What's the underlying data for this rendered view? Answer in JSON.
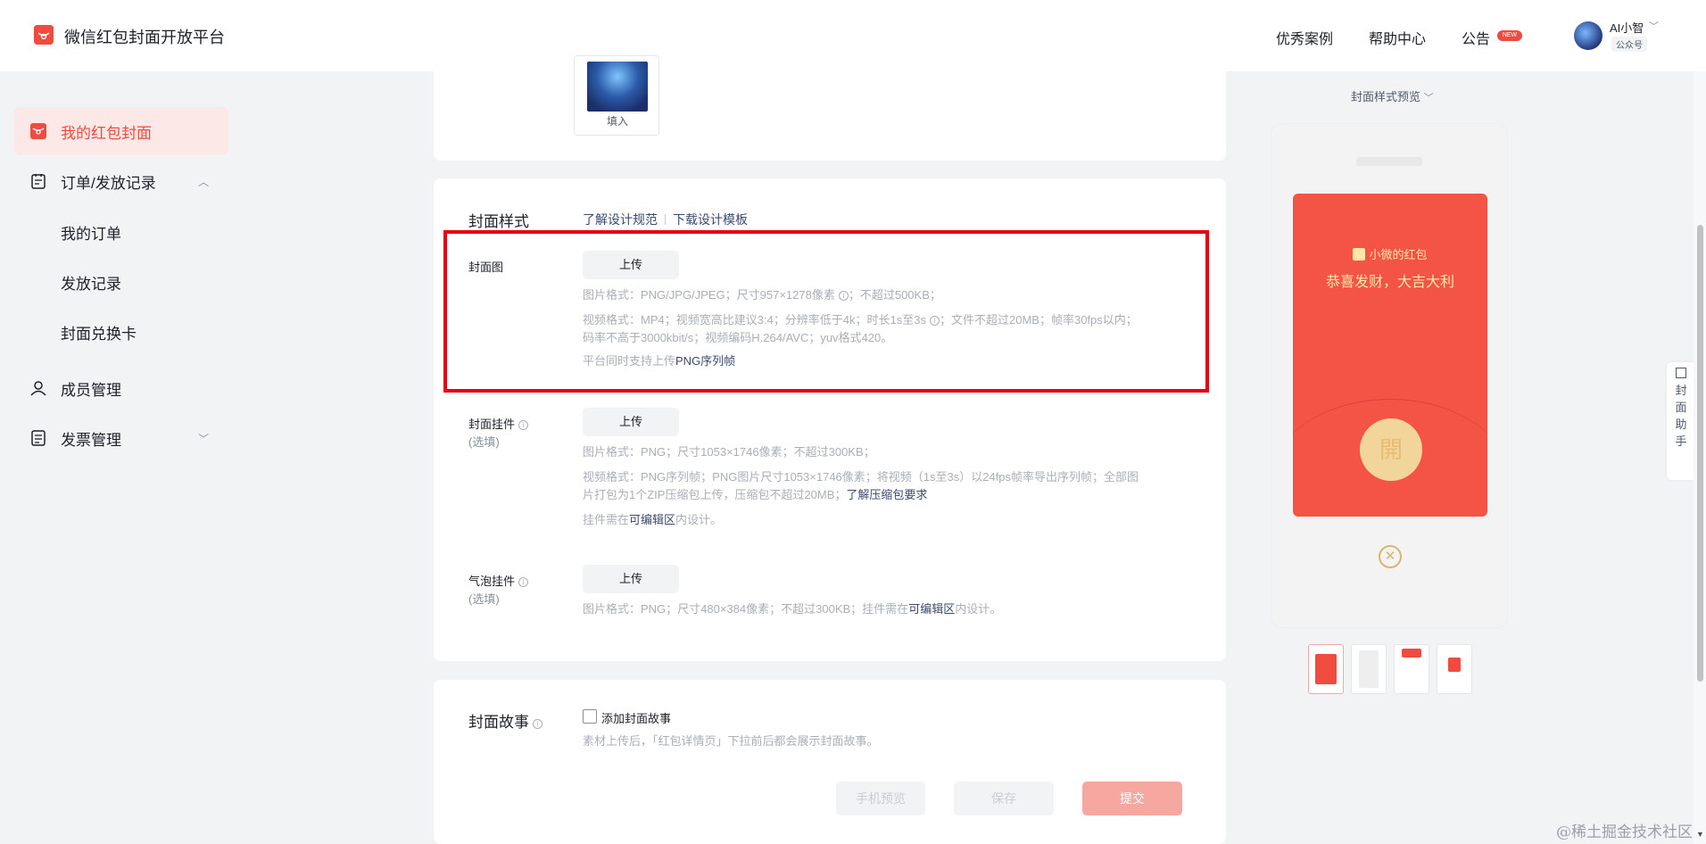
{
  "header": {
    "brand": "微信红包封面开放平台",
    "nav": {
      "cases": "优秀案例",
      "help": "帮助中心",
      "notice": "公告",
      "new_badge": "NEW"
    },
    "user": {
      "name": "AI小智",
      "chevron": "﹀",
      "type": "公众号"
    }
  },
  "sidebar": {
    "my_covers": "我的红包封面",
    "orders": "订单/发放记录",
    "orders_chevron": "︿",
    "my_orders": "我的订单",
    "issue_records": "发放记录",
    "redeem_card": "封面兑换卡",
    "members": "成员管理",
    "invoices": "发票管理",
    "invoices_chevron": "﹀"
  },
  "top_card": {
    "fill_label": "填入"
  },
  "style_card": {
    "title": "封面样式",
    "link_spec": "了解设计规范",
    "link_template": "下载设计模板",
    "cover_image": {
      "label": "封面图",
      "upload": "上传",
      "hint1_a": "图片格式：PNG/JPG/JPEG；尺寸957×1278像素",
      "hint1_b": "；不超过500KB；",
      "hint2_a": "视频格式：MP4；视频宽高比建议3:4；分辨率低于4k；时长1s至3s",
      "hint2_b": "；文件不超过20MB；帧率30fps以内；",
      "hint2_c": "码率不高于3000kbit/s；视频编码H.264/AVC；yuv格式420。",
      "hint3_a": "平台同时支持上传",
      "hint3_b": "PNG序列帧"
    },
    "pendant": {
      "label": "封面挂件",
      "optional": "(选填)",
      "upload": "上传",
      "hint1": "图片格式：PNG；尺寸1053×1746像素；不超过300KB；",
      "hint2": "视频格式：PNG序列帧；PNG图片尺寸1053×1746像素；将视频（1s至3s）以24fps帧率导出序列帧；全部图",
      "hint3_a": "片打包为1个ZIP压缩包上传，压缩包不超过20MB；",
      "hint3_b": "了解压缩包要求",
      "hint4_a": "挂件需在",
      "hint4_b": "可编辑区",
      "hint4_c": "内设计。"
    },
    "bubble": {
      "label": "气泡挂件",
      "optional": "(选填)",
      "upload": "上传",
      "hint_a": "图片格式：PNG；尺寸480×384像素；不超过300KB；挂件需在",
      "hint_b": "可编辑区",
      "hint_c": "内设计。"
    }
  },
  "story_card": {
    "title": "封面故事",
    "checkbox_label": "添加封面故事",
    "hint": "素材上传后，「红包详情页」下拉前后都会展示封面故事。",
    "btn_preview": "手机预览",
    "btn_save": "保存",
    "btn_submit": "提交"
  },
  "preview": {
    "title": "封面样式预览",
    "chevron": "﹀",
    "sender": "小微的红包",
    "greeting": "恭喜发财，大吉大利",
    "open_char": "開",
    "close_char": "✕"
  },
  "helper": {
    "chars": [
      "封",
      "面",
      "助",
      "手"
    ]
  },
  "watermark": "@稀土掘金技术社区",
  "colors": {
    "brand_red": "#f04b3f",
    "highlight_box": "#e60012",
    "link": "#3a4a6e",
    "envelope": "#f35445"
  }
}
